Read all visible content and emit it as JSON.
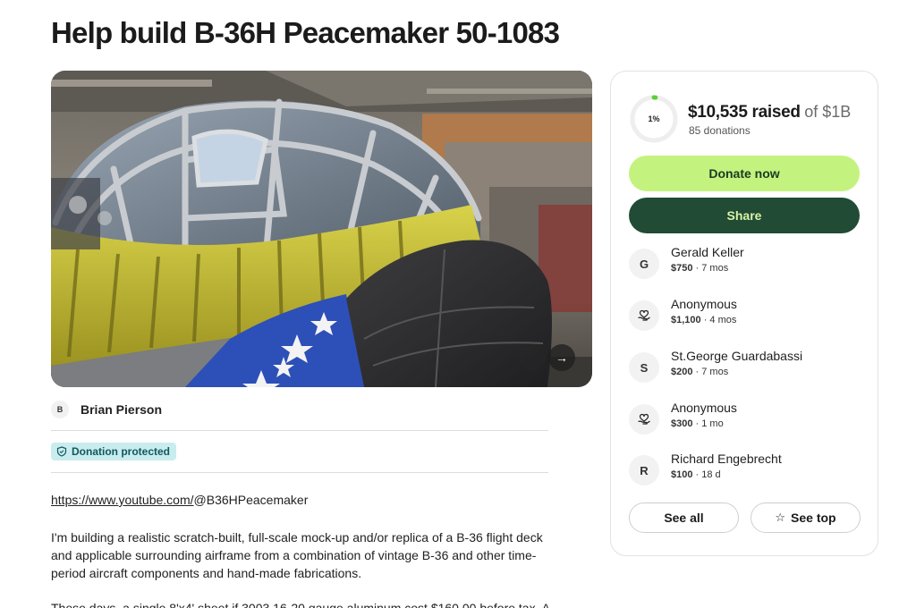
{
  "page": {
    "title": "Help build B-36H Peacemaker 50-1083"
  },
  "organizer": {
    "initial": "B",
    "name": "Brian Pierson"
  },
  "badge": {
    "label": "Donation protected",
    "icon": "shield-icon"
  },
  "story": {
    "link_prefix": "https://www.youtube.com/",
    "link_suffix": "@B36HPeacemaker",
    "paragraph_1": "I'm building a realistic scratch-built, full-scale mock-up and/or replica of a B-36 flight deck and applicable surrounding airframe from a combination of vintage B-36 and other time-period aircraft components and hand-made fabrications.",
    "paragraph_2": "These days, a single 8'x4' sheet if 3003 16-20 gauge aluminum cost $160.00 before tax. A"
  },
  "fundraiser": {
    "progress_fraction": 0.01,
    "progress_label": "1%",
    "raised": "$10,535 raised",
    "goal": "of $1B",
    "donations": "85 donations",
    "donate_label": "Donate now",
    "share_label": "Share",
    "see_all_label": "See all",
    "see_top_label": "See top",
    "accent_color": "#c3f37e",
    "share_color": "#214b34"
  },
  "donors": [
    {
      "initial": "G",
      "name": "Gerald Keller",
      "amount": "$750",
      "time": " · 7 mos",
      "icon": ""
    },
    {
      "initial": "",
      "name": "Anonymous",
      "amount": "$1,100",
      "time": " · 4 mos",
      "icon": "heart-hand-icon"
    },
    {
      "initial": "S",
      "name": "St.George Guardabassi",
      "amount": "$200",
      "time": " · 7 mos",
      "icon": ""
    },
    {
      "initial": "",
      "name": "Anonymous",
      "amount": "$300",
      "time": " · 1 mo",
      "icon": "heart-hand-icon"
    },
    {
      "initial": "R",
      "name": "Richard Engebrecht",
      "amount": "$100",
      "time": " · 18 d",
      "icon": ""
    }
  ]
}
